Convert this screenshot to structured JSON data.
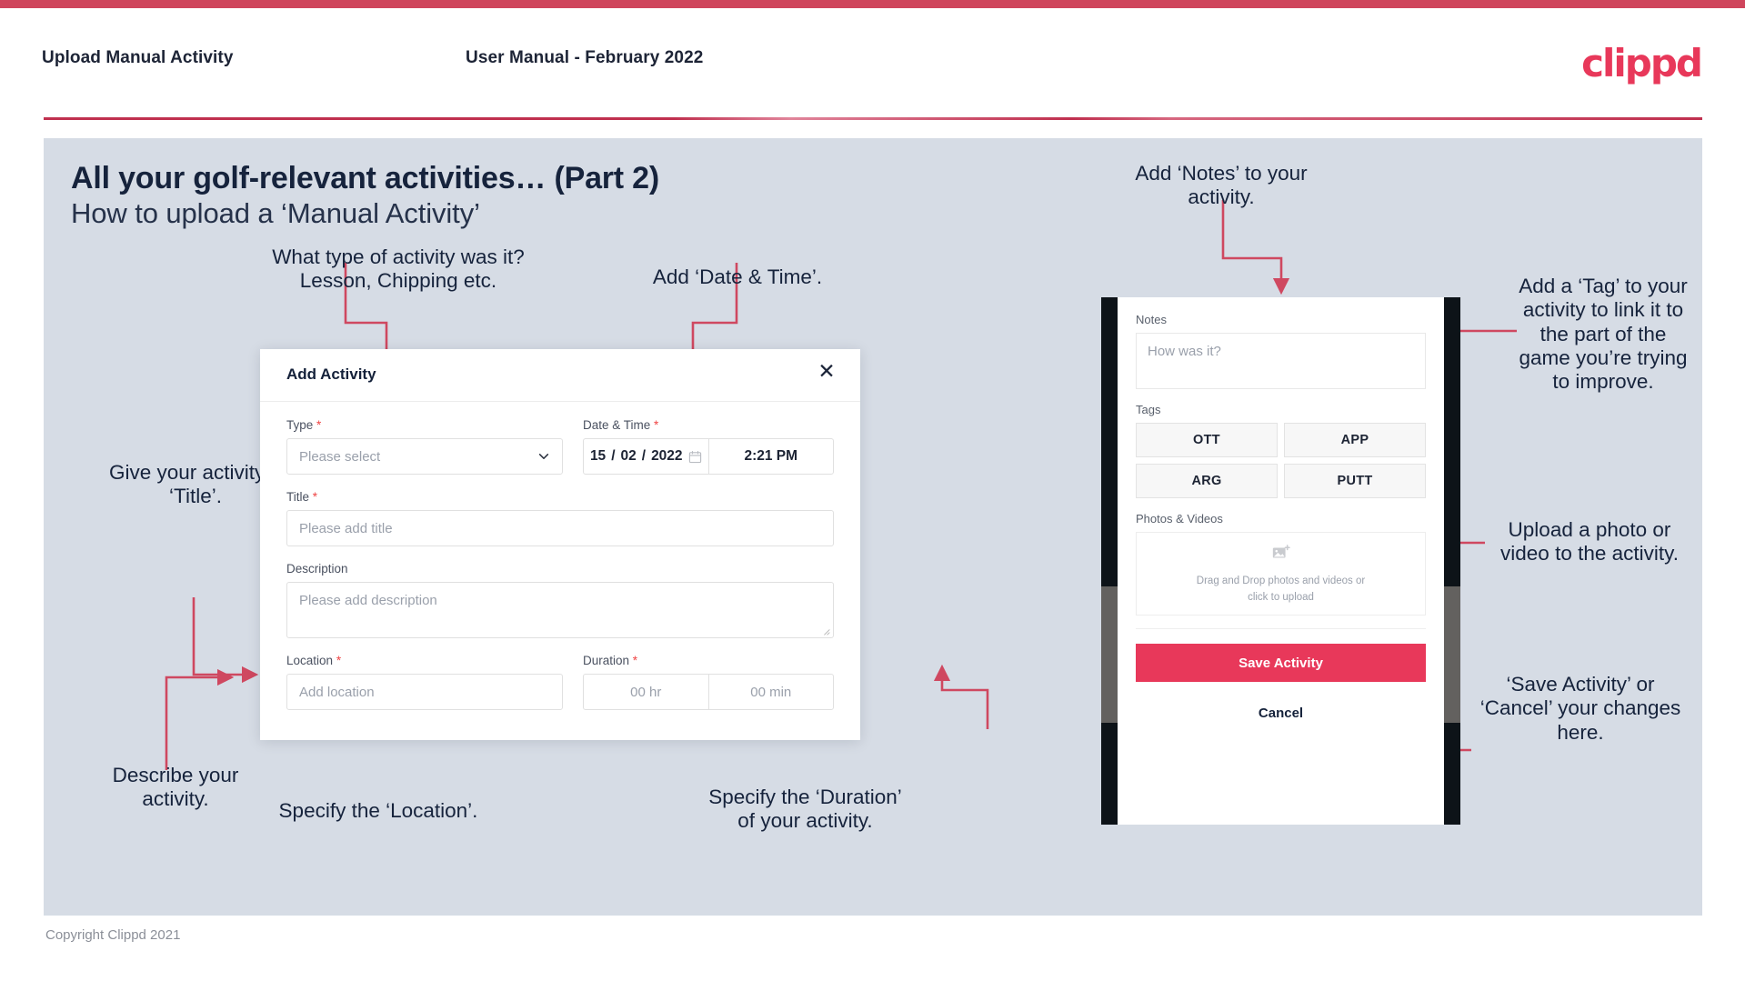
{
  "header": {
    "left_title": "Upload Manual Activity",
    "center_title": "User Manual - February 2022",
    "logo_text": "clippd"
  },
  "slide": {
    "title": "All your golf-relevant activities… (Part 2)",
    "subtitle": "How to upload a ‘Manual Activity’"
  },
  "annotations": {
    "type_note": "What type of activity was it?\nLesson, Chipping etc.",
    "datetime_note": "Add ‘Date & Time’.",
    "title_note": "Give your activity a\n‘Title’.",
    "description_note": "Describe your\nactivity.",
    "location_note": "Specify the ‘Location’.",
    "duration_note": "Specify the ‘Duration’\nof your activity.",
    "notes_note": "Add ‘Notes’ to your\nactivity.",
    "tags_note": "Add a ‘Tag’ to your\nactivity to link it to\nthe part of the\ngame you’re trying\nto improve.",
    "upload_note": "Upload a photo or\nvideo to the activity.",
    "save_note": "‘Save Activity’ or\n‘Cancel’ your changes\nhere."
  },
  "modal": {
    "title": "Add Activity",
    "close_icon": "close-icon",
    "fields": {
      "type": {
        "label": "Type",
        "required": "*",
        "placeholder": "Please select",
        "chevron_icon": "chevron-down-icon"
      },
      "datetime": {
        "label": "Date & Time",
        "required": "*",
        "day": "15",
        "slash1": "/",
        "month": "02",
        "slash2": "/",
        "year": "2022",
        "calendar_icon": "calendar-icon",
        "time": "2:21 PM"
      },
      "title": {
        "label": "Title",
        "required": "*",
        "placeholder": "Please add title"
      },
      "description": {
        "label": "Description",
        "required": "",
        "placeholder": "Please add description"
      },
      "location": {
        "label": "Location",
        "required": "*",
        "placeholder": "Add location"
      },
      "duration": {
        "label": "Duration",
        "required": "*",
        "hours_placeholder": "00 hr",
        "minutes_placeholder": "00 min"
      }
    }
  },
  "phone": {
    "notes": {
      "label": "Notes",
      "placeholder": "How was it?"
    },
    "tags": {
      "label": "Tags",
      "items": [
        "OTT",
        "APP",
        "ARG",
        "PUTT"
      ]
    },
    "photos": {
      "label": "Photos & Videos",
      "icon": "add-image-icon",
      "drop_line1": "Drag and Drop photos and videos or",
      "drop_line2": "click to upload"
    },
    "save_label": "Save Activity",
    "cancel_label": "Cancel"
  },
  "footer": {
    "copyright": "Copyright Clippd 2021"
  },
  "colors": {
    "accent": "#cf455c",
    "brand": "#e8385a",
    "panel_bg": "#d6dce5",
    "text": "#16233c",
    "required": "#ef4444"
  }
}
